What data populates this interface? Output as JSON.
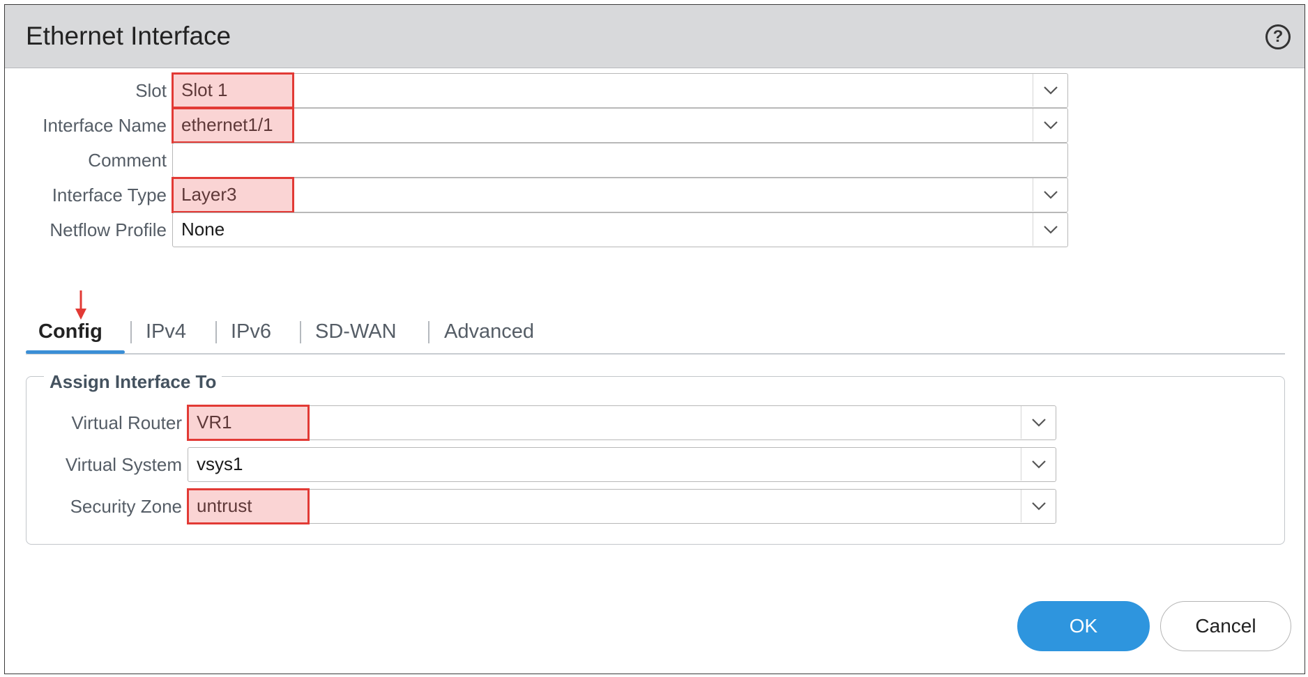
{
  "dialog": {
    "title": "Ethernet Interface",
    "help_icon": "help-circle-icon"
  },
  "form": {
    "slot": {
      "label": "Slot",
      "value": "Slot 1"
    },
    "interface_name": {
      "label": "Interface Name",
      "value": "ethernet1/1"
    },
    "comment": {
      "label": "Comment",
      "value": ""
    },
    "interface_type": {
      "label": "Interface Type",
      "value": "Layer3"
    },
    "netflow_profile": {
      "label": "Netflow Profile",
      "value": "None"
    }
  },
  "tabs": [
    {
      "label": "Config",
      "active": true
    },
    {
      "label": "IPv4"
    },
    {
      "label": "IPv6"
    },
    {
      "label": "SD-WAN"
    },
    {
      "label": "Advanced"
    }
  ],
  "assign": {
    "legend": "Assign Interface To",
    "virtual_router": {
      "label": "Virtual Router",
      "value": "VR1"
    },
    "virtual_system": {
      "label": "Virtual System",
      "value": "vsys1"
    },
    "security_zone": {
      "label": "Security Zone",
      "value": "untrust"
    }
  },
  "buttons": {
    "ok": "OK",
    "cancel": "Cancel"
  },
  "annotation": {
    "highlight_color": "#e23a35",
    "arrow_color": "#e23a35"
  }
}
